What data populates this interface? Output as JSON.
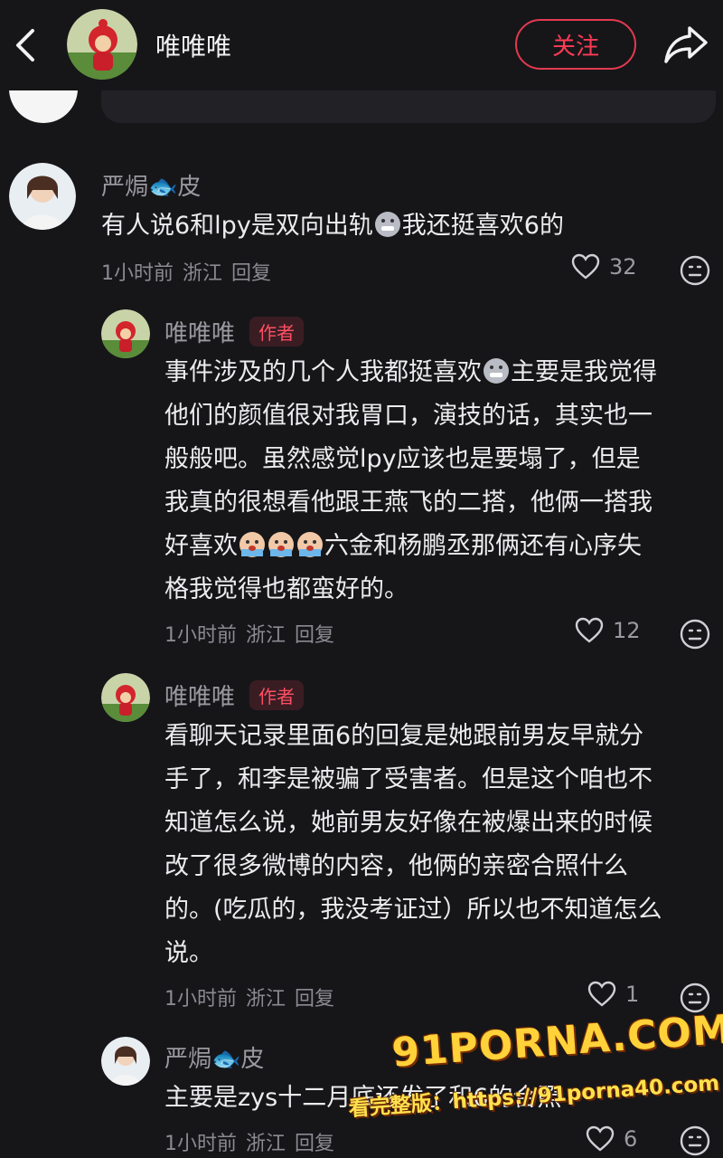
{
  "header": {
    "title": "唯唯唯",
    "follow_label": "关注"
  },
  "comments": [
    {
      "user": "严焗🐟皮",
      "text": "有人说6和lpy是双向出轨",
      "text_after": "我还挺喜欢6的",
      "time": "1小时前",
      "location": "浙江",
      "reply": "回复",
      "likes": "32"
    },
    {
      "user": "唯唯唯",
      "badge": "作者",
      "lines": [
        "事件涉及的几个人我都挺喜欢",
        "主要是我觉得",
        "他们的颜值很对我胃口，演技的话，其实也一",
        "般般吧。虽然感觉lpy应该也是要塌了，但是",
        "我真的很想看他跟王燕飞的二搭，他俩一搭我",
        "好喜欢",
        "六金和杨鹏丞那俩还有心序失",
        "格我觉得也都蛮好的。"
      ],
      "time": "1小时前",
      "location": "浙江",
      "reply": "回复",
      "likes": "12"
    },
    {
      "user": "唯唯唯",
      "badge": "作者",
      "lines": [
        "看聊天记录里面6的回复是她跟前男友早就分",
        "手了，和李是被骗了受害者。但是这个咱也不",
        "知道怎么说，她前男友好像在被爆出来的时候",
        "改了很多微博的内容，他俩的亲密合照什么",
        "的。(吃瓜的，我没考证过）所以也不知道怎么",
        "说。"
      ],
      "time": "1小时前",
      "location": "浙江",
      "reply": "回复",
      "likes": "1"
    },
    {
      "user": "严焗🐟皮",
      "text": "主要是zys十二月底还发了和6的合照",
      "time": "1小时前",
      "location": "浙江",
      "reply": "回复",
      "likes": "6"
    }
  ],
  "watermark": {
    "logo": "91PORNA.COM",
    "url": "看完整版：https://91porna40.com"
  },
  "icons": [
    "back-icon",
    "share-icon",
    "heart-icon",
    "emoji-face-icon",
    "fish-icon",
    "grimace-emoji",
    "crying-emoji"
  ],
  "colors": {
    "background": "#161619",
    "accent": "#ff3b55",
    "badge_bg": "#3a1d23",
    "muted": "#8a8a91"
  }
}
